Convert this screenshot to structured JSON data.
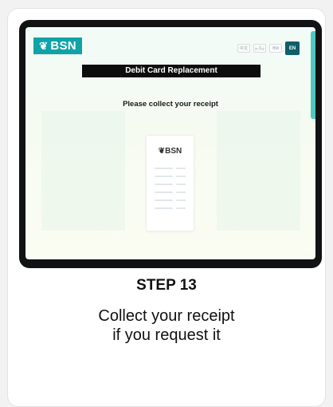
{
  "kiosk": {
    "logo_text": "BSN",
    "languages": [
      "中文",
      "தமிழ்",
      "BM",
      "EN"
    ],
    "active_language": "EN",
    "title": "Debit Card Replacement",
    "instruction": "Please collect your receipt",
    "receipt_logo": "BSN"
  },
  "step": {
    "label": "STEP 13",
    "description_line1": "Collect your receipt",
    "description_line2": "if you request it"
  },
  "colors": {
    "brand_teal": "#0fa3a8",
    "active_lang": "#0f5f6a",
    "title_bar": "#0d0d0d"
  }
}
